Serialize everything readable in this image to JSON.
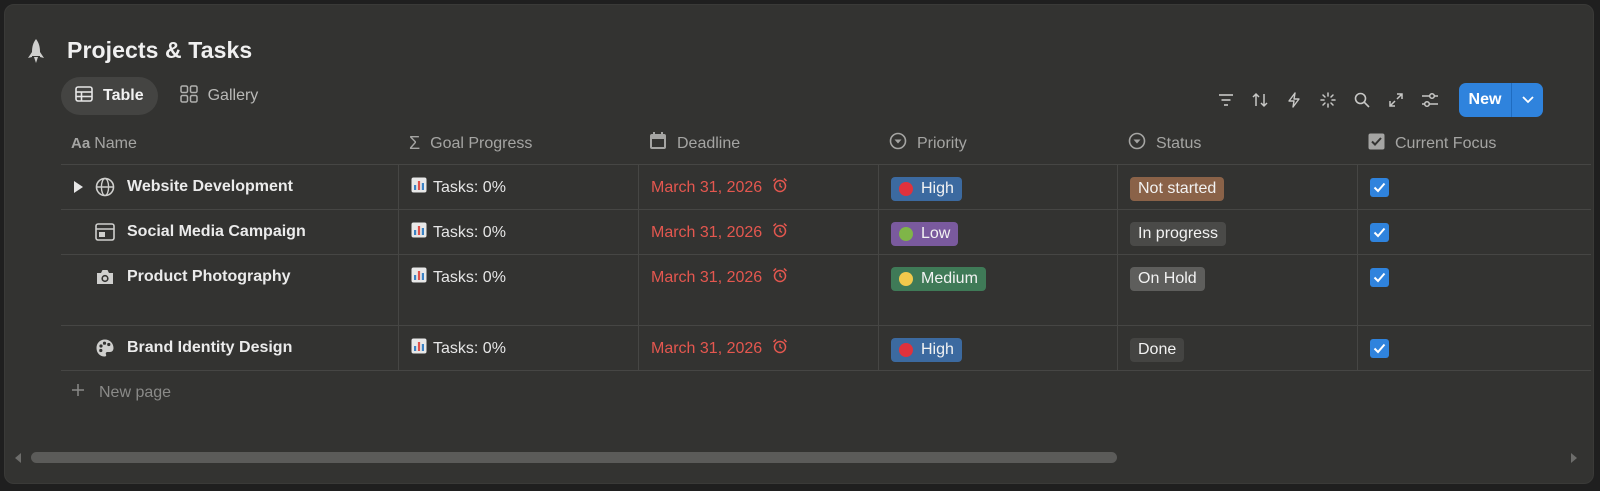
{
  "page": {
    "title": "Projects & Tasks",
    "icon": "rocket-icon"
  },
  "views": [
    {
      "label": "Table",
      "icon": "table-icon",
      "active": true
    },
    {
      "label": "Gallery",
      "icon": "gallery-icon",
      "active": false
    }
  ],
  "toolbar": {
    "icons": [
      "filter-icon",
      "sort-icon",
      "automation-icon",
      "magic-icon",
      "search-icon",
      "expand-icon",
      "settings-icon"
    ],
    "new_label": "New"
  },
  "columns": [
    {
      "label": "Name",
      "icon": "text-type-icon"
    },
    {
      "label": "Goal Progress",
      "icon": "sigma-icon"
    },
    {
      "label": "Deadline",
      "icon": "calendar-icon"
    },
    {
      "label": "Priority",
      "icon": "select-icon"
    },
    {
      "label": "Status",
      "icon": "status-icon"
    },
    {
      "label": "Current Focus",
      "icon": "checkbox-icon"
    }
  ],
  "rows": [
    {
      "name": "Website Development",
      "icon": "globe-icon",
      "progress": "Tasks: 0%",
      "deadline": "March 31, 2026",
      "priority": "High",
      "status": "Not started",
      "focus": true
    },
    {
      "name": "Social Media Campaign",
      "icon": "browser-icon",
      "progress": "Tasks: 0%",
      "deadline": "March 31, 2026",
      "priority": "Low",
      "status": "In progress",
      "focus": true
    },
    {
      "name": "Product Photography",
      "icon": "camera-icon",
      "progress": "Tasks: 0%",
      "deadline": "March 31, 2026",
      "priority": "Medium",
      "status": "On Hold",
      "focus": true
    },
    {
      "name": "Brand Identity Design",
      "icon": "palette-icon",
      "progress": "Tasks: 0%",
      "deadline": "March 31, 2026",
      "priority": "High",
      "status": "Done",
      "focus": true
    }
  ],
  "new_page_label": "New page",
  "colors": {
    "accent": "#2f83dd",
    "deadline": "#e4574f",
    "priority_high_bg": "#3c6aa0",
    "priority_high_dot": "#e0323c",
    "priority_low_bg": "#7a5a9e",
    "priority_low_dot": "#7fb548",
    "priority_medium_bg": "#3f7a57",
    "priority_medium_dot": "#f2c94c",
    "status_not_started_bg": "#8a6248",
    "status_in_progress_bg": "#4a4a48",
    "status_on_hold_bg": "#5e5e5c",
    "status_done_bg": "#444442"
  }
}
